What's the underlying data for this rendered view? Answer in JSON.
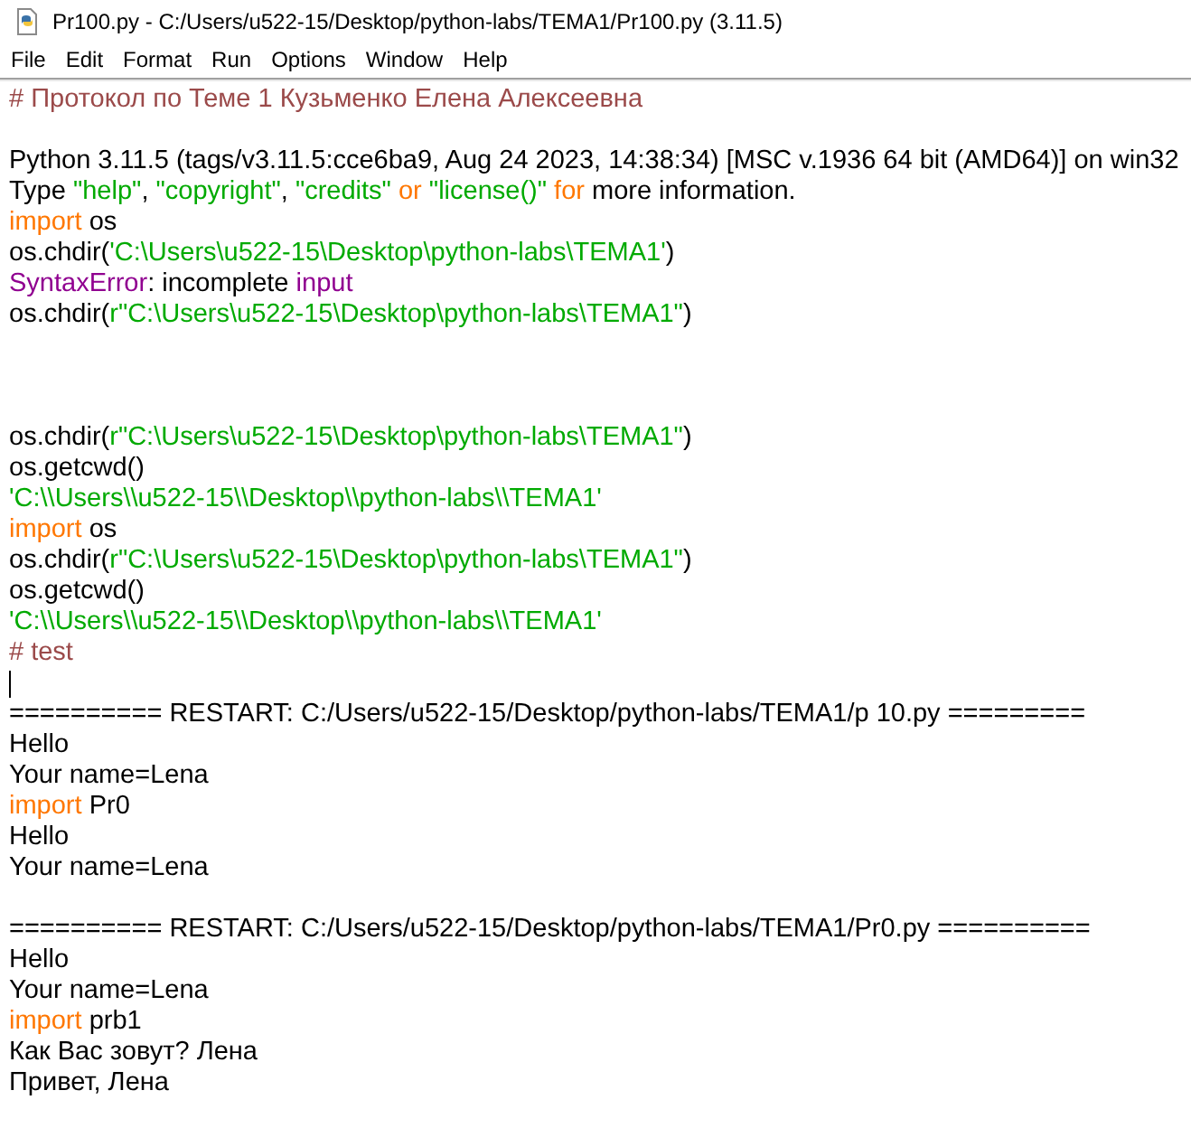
{
  "window": {
    "title": "Pr100.py - C:/Users/u522-15/Desktop/python-labs/TEMA1/Pr100.py (3.11.5)"
  },
  "menu": [
    "File",
    "Edit",
    "Format",
    "Run",
    "Options",
    "Window",
    "Help"
  ],
  "lines": [
    {
      "kind": "code",
      "tokens": [
        {
          "kind": "comment",
          "text": "# Протокол по Теме 1 Кузьменко Елена Алексеевна"
        }
      ]
    },
    {
      "kind": "blank"
    },
    {
      "kind": "code",
      "tokens": [
        {
          "kind": "plain",
          "text": "Python 3.11.5 (tags/v3.11.5:cce6ba9, Aug 24 2023, 14:38:34) [MSC v.1936 64 bit (AMD64)] on win32"
        }
      ]
    },
    {
      "kind": "code",
      "tokens": [
        {
          "kind": "plain",
          "text": "Type "
        },
        {
          "kind": "string",
          "text": "\"help\""
        },
        {
          "kind": "plain",
          "text": ", "
        },
        {
          "kind": "string",
          "text": "\"copyright\""
        },
        {
          "kind": "plain",
          "text": ", "
        },
        {
          "kind": "string",
          "text": "\"credits\""
        },
        {
          "kind": "keyword",
          "text": " or "
        },
        {
          "kind": "string",
          "text": "\"license()\""
        },
        {
          "kind": "keyword",
          "text": " for"
        },
        {
          "kind": "plain",
          "text": " more information."
        }
      ]
    },
    {
      "kind": "code",
      "tokens": [
        {
          "kind": "keyword",
          "text": "import"
        },
        {
          "kind": "plain",
          "text": " os"
        }
      ]
    },
    {
      "kind": "code",
      "tokens": [
        {
          "kind": "plain",
          "text": "os.chdir("
        },
        {
          "kind": "string",
          "text": "'C:\\Users\\u522-15\\Desktop\\python-labs\\TEMA1'"
        },
        {
          "kind": "plain",
          "text": ")"
        }
      ]
    },
    {
      "kind": "code",
      "tokens": [
        {
          "kind": "builtin",
          "text": "SyntaxError"
        },
        {
          "kind": "plain",
          "text": ": incomplete "
        },
        {
          "kind": "builtin",
          "text": "input"
        }
      ]
    },
    {
      "kind": "code",
      "tokens": [
        {
          "kind": "plain",
          "text": "os.chdir("
        },
        {
          "kind": "string",
          "text": "r\"C:\\Users\\u522-15\\Desktop\\python-labs\\TEMA1\""
        },
        {
          "kind": "plain",
          "text": ")"
        }
      ]
    },
    {
      "kind": "blank"
    },
    {
      "kind": "blank"
    },
    {
      "kind": "blank"
    },
    {
      "kind": "code",
      "tokens": [
        {
          "kind": "plain",
          "text": "os.chdir("
        },
        {
          "kind": "string",
          "text": "r\"C:\\Users\\u522-15\\Desktop\\python-labs\\TEMA1\""
        },
        {
          "kind": "plain",
          "text": ")"
        }
      ]
    },
    {
      "kind": "code",
      "tokens": [
        {
          "kind": "plain",
          "text": "os.getcwd()"
        }
      ]
    },
    {
      "kind": "code",
      "tokens": [
        {
          "kind": "string",
          "text": "'C:\\\\Users\\\\u522-15\\\\Desktop\\\\python-labs\\\\TEMA1'"
        }
      ]
    },
    {
      "kind": "code",
      "tokens": [
        {
          "kind": "keyword",
          "text": "import"
        },
        {
          "kind": "plain",
          "text": " os"
        }
      ]
    },
    {
      "kind": "code",
      "tokens": [
        {
          "kind": "plain",
          "text": "os.chdir("
        },
        {
          "kind": "string",
          "text": "r\"C:\\Users\\u522-15\\Desktop\\python-labs\\TEMA1\""
        },
        {
          "kind": "plain",
          "text": ")"
        }
      ]
    },
    {
      "kind": "code",
      "tokens": [
        {
          "kind": "plain",
          "text": "os.getcwd()"
        }
      ]
    },
    {
      "kind": "code",
      "tokens": [
        {
          "kind": "string",
          "text": "'C:\\\\Users\\\\u522-15\\\\Desktop\\\\python-labs\\\\TEMA1'"
        }
      ]
    },
    {
      "kind": "code",
      "tokens": [
        {
          "kind": "comment",
          "text": "# test"
        }
      ]
    },
    {
      "kind": "cursor"
    },
    {
      "kind": "code",
      "tokens": [
        {
          "kind": "plain",
          "text": "========== RESTART: C:/Users/u522-15/Desktop/python-labs/TEMA1/p 10.py ========="
        }
      ]
    },
    {
      "kind": "code",
      "tokens": [
        {
          "kind": "plain",
          "text": "Hello"
        }
      ]
    },
    {
      "kind": "code",
      "tokens": [
        {
          "kind": "plain",
          "text": "Your name=Lena"
        }
      ]
    },
    {
      "kind": "code",
      "tokens": [
        {
          "kind": "keyword",
          "text": "import"
        },
        {
          "kind": "plain",
          "text": " Pr0"
        }
      ]
    },
    {
      "kind": "code",
      "tokens": [
        {
          "kind": "plain",
          "text": "Hello"
        }
      ]
    },
    {
      "kind": "code",
      "tokens": [
        {
          "kind": "plain",
          "text": "Your name=Lena"
        }
      ]
    },
    {
      "kind": "blank"
    },
    {
      "kind": "code",
      "tokens": [
        {
          "kind": "plain",
          "text": "========== RESTART: C:/Users/u522-15/Desktop/python-labs/TEMA1/Pr0.py =========="
        }
      ]
    },
    {
      "kind": "code",
      "tokens": [
        {
          "kind": "plain",
          "text": "Hello"
        }
      ]
    },
    {
      "kind": "code",
      "tokens": [
        {
          "kind": "plain",
          "text": "Your name=Lena"
        }
      ]
    },
    {
      "kind": "code",
      "tokens": [
        {
          "kind": "keyword",
          "text": "import"
        },
        {
          "kind": "plain",
          "text": " prb1"
        }
      ]
    },
    {
      "kind": "code",
      "tokens": [
        {
          "kind": "plain",
          "text": "Как Вас зовут? Лена"
        }
      ]
    },
    {
      "kind": "code",
      "tokens": [
        {
          "kind": "plain",
          "text": "Привет, Лена"
        }
      ]
    }
  ]
}
